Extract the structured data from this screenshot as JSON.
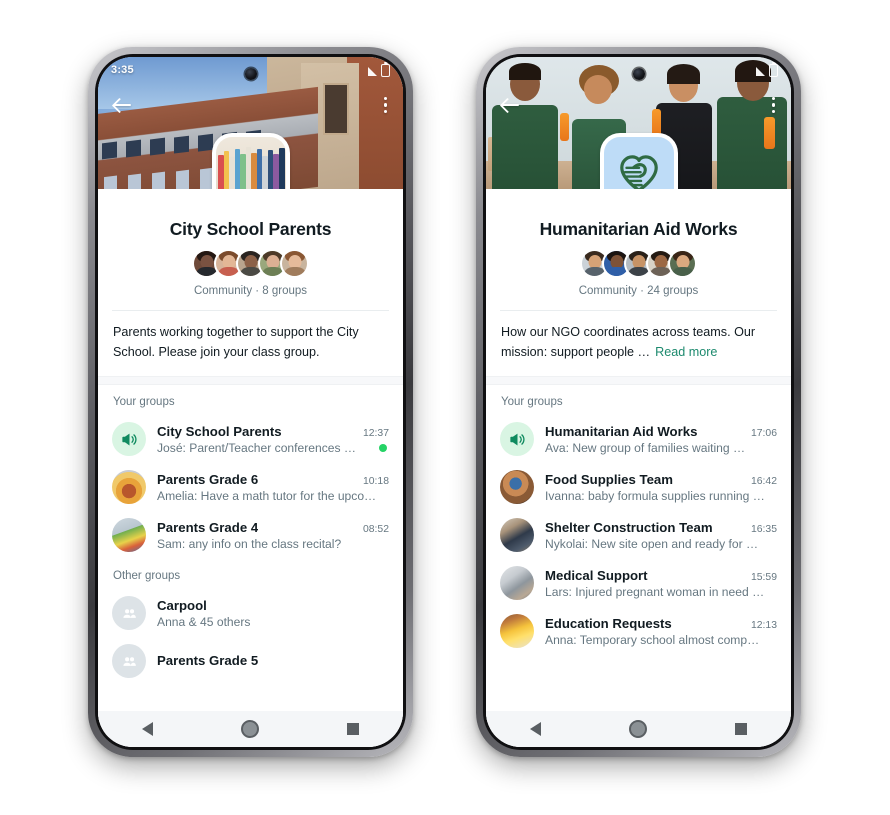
{
  "phones": [
    {
      "status": {
        "clock": "3:35"
      },
      "topbar": {
        "back_icon": "back-arrow-icon",
        "menu_icon": "overflow-menu-icon"
      },
      "logo": {
        "type": "photo-books",
        "alt": "books-photo"
      },
      "community": {
        "title": "City School Parents",
        "meta": "Community · 8 groups",
        "description": "Parents working together to support the City School. Please join your class group.",
        "read_more": ""
      },
      "avatars_count": 5,
      "sections": [
        {
          "heading": "Your groups",
          "rows": [
            {
              "name": "City School Parents",
              "time": "12:37",
              "message": "José: Parent/Teacher conferences …",
              "avatar": "announcement",
              "unread": true
            },
            {
              "name": "Parents Grade 6",
              "time": "10:18",
              "message": "Amelia: Have a math tutor for the upco…",
              "avatar": "photo-craft",
              "unread": false
            },
            {
              "name": "Parents Grade 4",
              "time": "08:52",
              "message": "Sam: any info on the class recital?",
              "avatar": "photo-kids",
              "unread": false
            }
          ]
        },
        {
          "heading": "Other groups",
          "rows": [
            {
              "name": "Carpool",
              "time": "",
              "message": "Anna & 45 others",
              "avatar": "placeholder",
              "unread": false
            },
            {
              "name": "Parents Grade 5",
              "time": "",
              "message": "",
              "avatar": "placeholder",
              "unread": false
            }
          ]
        }
      ],
      "navbar": {
        "back": "nav-back-icon",
        "home": "nav-home-icon",
        "recents": "nav-recents-icon"
      }
    },
    {
      "status": {
        "clock": ""
      },
      "topbar": {
        "back_icon": "back-arrow-icon",
        "menu_icon": "overflow-menu-icon"
      },
      "logo": {
        "type": "heart-hands",
        "alt": "heart-hands-logo"
      },
      "community": {
        "title": "Humanitarian Aid Works",
        "meta": "Community · 24 groups",
        "description": "How our NGO coordinates across teams. Our mission: support people …",
        "read_more": "Read more"
      },
      "avatars_count": 5,
      "sections": [
        {
          "heading": "Your groups",
          "rows": [
            {
              "name": "Humanitarian Aid Works",
              "time": "17:06",
              "message": "Ava: New group of families waiting …",
              "avatar": "announcement",
              "unread": false
            },
            {
              "name": "Food Supplies Team",
              "time": "16:42",
              "message": "Ivanna: baby formula supplies running …",
              "avatar": "photo-food",
              "unread": false
            },
            {
              "name": "Shelter Construction Team",
              "time": "16:35",
              "message": "Nykolai: New site open and ready for …",
              "avatar": "photo-shelter",
              "unread": false
            },
            {
              "name": "Medical Support",
              "time": "15:59",
              "message": "Lars: Injured pregnant woman in need …",
              "avatar": "photo-medical",
              "unread": false
            },
            {
              "name": "Education Requests",
              "time": "12:13",
              "message": "Anna: Temporary school almost comp…",
              "avatar": "photo-education",
              "unread": false
            }
          ]
        }
      ],
      "navbar": {
        "back": "nav-back-icon",
        "home": "nav-home-icon",
        "recents": "nav-recents-icon"
      }
    }
  ],
  "colors": {
    "unread_dot": "#25d366",
    "read_more": "#1d8a6e",
    "announce_bg": "#d9f5e3",
    "announce_fg": "#0f8a5f",
    "logo_blue": "#bedcf7",
    "logo_green": "#2f6b43",
    "text_primary": "#111b21",
    "text_secondary": "#667781"
  }
}
